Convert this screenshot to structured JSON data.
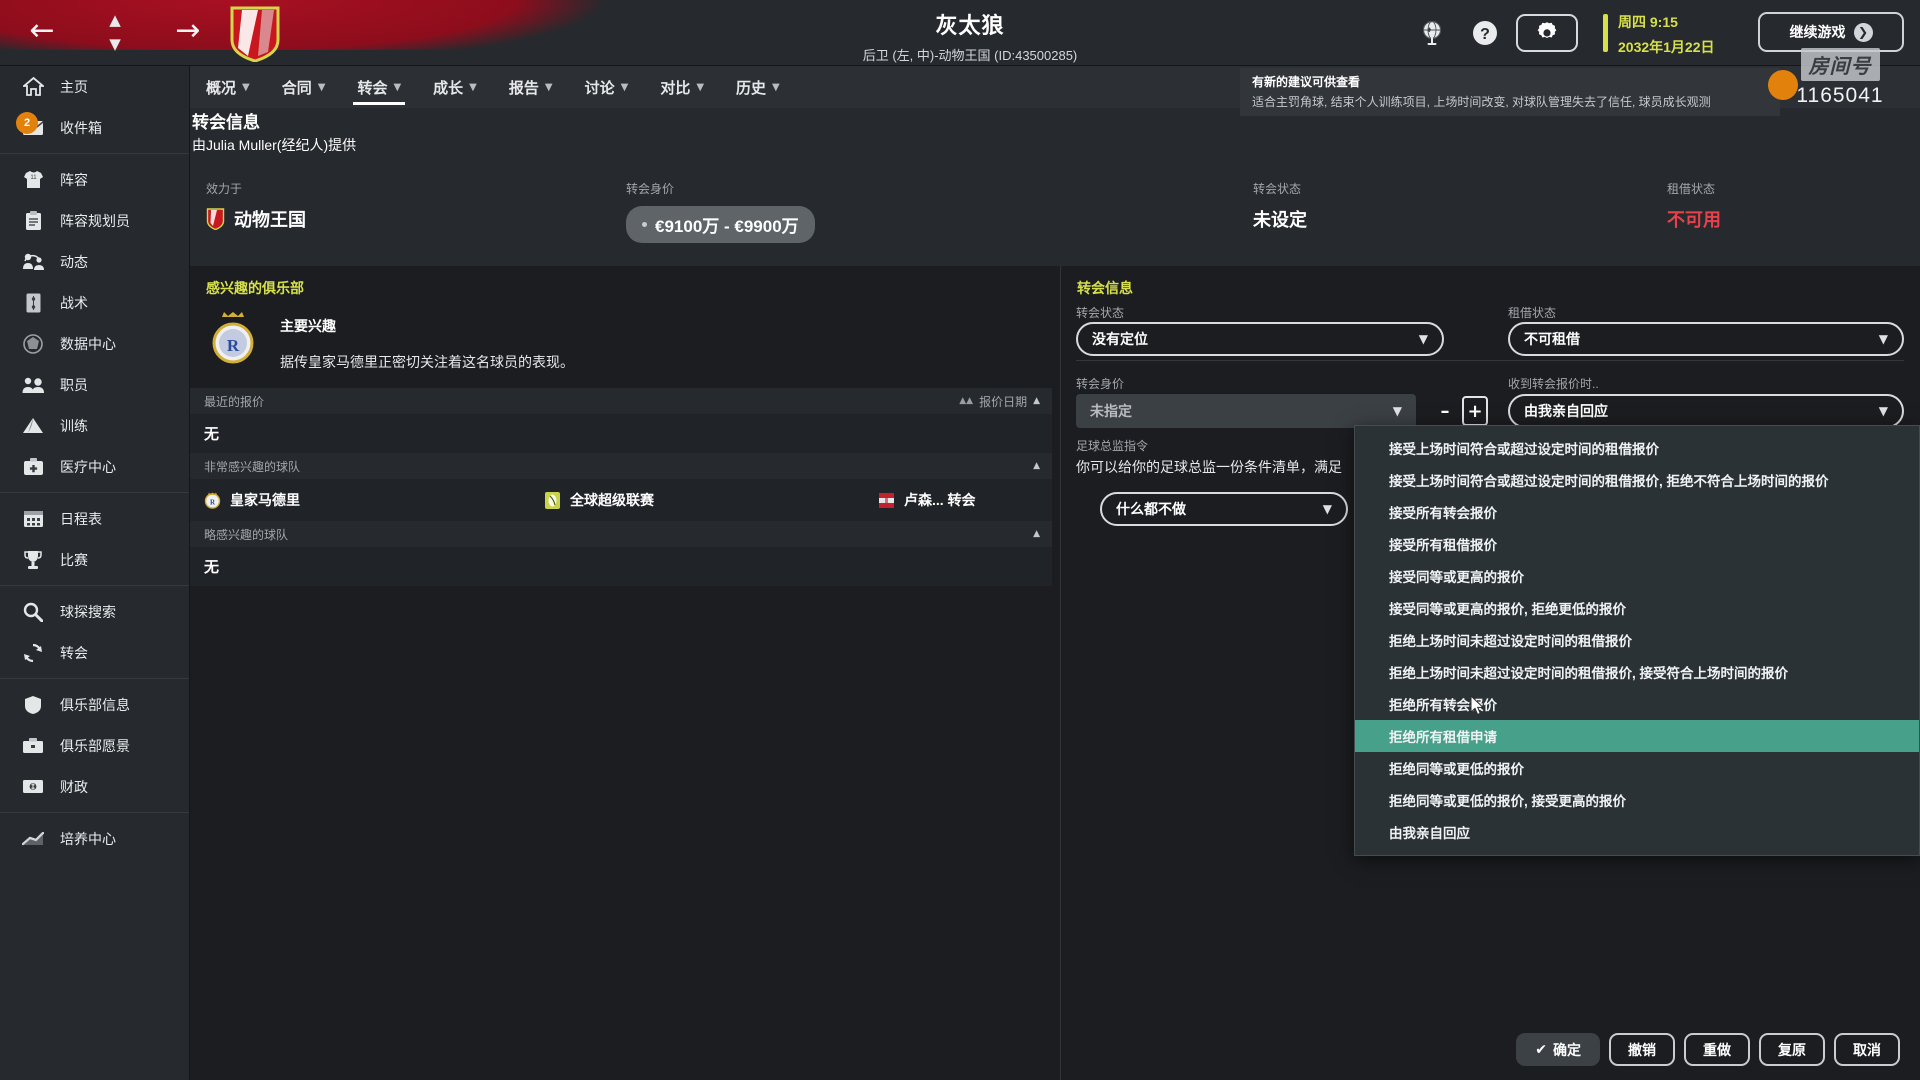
{
  "topbar": {
    "back_icon": "arrow-left-icon",
    "forward_icon": "arrow-right-icon",
    "player_name": "灰太狼",
    "player_subtitle": "后卫 (左, 中)-动物王国 (ID:43500285)",
    "globe_icon": "globe-icon",
    "help_icon": "help-icon",
    "gear_icon": "gear-icon",
    "date_time": "周四 9:15",
    "date_day": "2032年1月22日",
    "continue_label": "继续游戏",
    "date_color": "#d7e04a"
  },
  "sidebar": {
    "items": [
      {
        "label": "主页",
        "icon": "home-icon",
        "badge": ""
      },
      {
        "label": "收件箱",
        "icon": "inbox-icon",
        "badge": "2"
      },
      {
        "label": "阵容",
        "icon": "shirt-icon",
        "badge": ""
      },
      {
        "label": "阵容规划员",
        "icon": "clipboard-icon",
        "badge": ""
      },
      {
        "label": "动态",
        "icon": "activity-icon",
        "badge": ""
      },
      {
        "label": "战术",
        "icon": "tactics-icon",
        "badge": ""
      },
      {
        "label": "数据中心",
        "icon": "data-hub-icon",
        "badge": ""
      },
      {
        "label": "职员",
        "icon": "staff-icon",
        "badge": ""
      },
      {
        "label": "训练",
        "icon": "training-icon",
        "badge": ""
      },
      {
        "label": "医疗中心",
        "icon": "medical-icon",
        "badge": ""
      },
      {
        "label": "日程表",
        "icon": "calendar-icon",
        "badge": ""
      },
      {
        "label": "比赛",
        "icon": "trophy-icon",
        "badge": ""
      },
      {
        "label": "球探搜索",
        "icon": "search-icon",
        "badge": ""
      },
      {
        "label": "转会",
        "icon": "transfer-icon",
        "badge": ""
      },
      {
        "label": "俱乐部信息",
        "icon": "shield-icon",
        "badge": ""
      },
      {
        "label": "俱乐部愿景",
        "icon": "briefcase-icon",
        "badge": ""
      },
      {
        "label": "财政",
        "icon": "money-icon",
        "badge": ""
      },
      {
        "label": "培养中心",
        "icon": "growth-icon",
        "badge": ""
      }
    ]
  },
  "tabs": [
    {
      "label": "概况",
      "active": false
    },
    {
      "label": "合同",
      "active": false
    },
    {
      "label": "转会",
      "active": true
    },
    {
      "label": "成长",
      "active": false
    },
    {
      "label": "报告",
      "active": false
    },
    {
      "label": "讨论",
      "active": false
    },
    {
      "label": "对比",
      "active": false
    },
    {
      "label": "历史",
      "active": false
    }
  ],
  "page": {
    "title": "转会信息",
    "subtitle": "由Julia Muller(经纪人)提供"
  },
  "notification": {
    "title": "有新的建议可供查看",
    "text": "适合主罚角球, 结束个人训练项目, 上场时间改变, 对球队管理失去了信任, 球员成长观测"
  },
  "watermark": {
    "label": "房间号",
    "number": "1165041"
  },
  "info_strip": [
    {
      "label": "效力于",
      "value": "动物王国",
      "style": "crest"
    },
    {
      "label": "转会身价",
      "value": "€9100万 - €9900万",
      "style": "pill"
    },
    {
      "label": "转会状态",
      "value": "未设定",
      "style": "plain"
    },
    {
      "label": "租借状态",
      "value": "不可用",
      "style": "red"
    }
  ],
  "left_panel": {
    "heading": "感兴趣的俱乐部",
    "interest_title": "主要兴趣",
    "interest_desc": "据传皇家马德里正密切关注着这名球员的表现。",
    "sections": [
      {
        "label": "最近的报价",
        "right_label": "报价日期",
        "body": "无"
      },
      {
        "label": "非常感兴趣的球队",
        "right_label": "",
        "body": ""
      },
      {
        "label": "略感兴趣的球队",
        "right_label": "",
        "body": "无"
      }
    ],
    "teams": [
      {
        "label": "皇家马德里",
        "icon": "real-madrid-crest"
      },
      {
        "label": "全球超级联赛",
        "icon": "global-league-crest"
      },
      {
        "label": "卢森... 转会",
        "icon": "luxembourg-crest"
      }
    ]
  },
  "right_panel": {
    "heading": "转会信息",
    "fields": [
      {
        "label": "转会状态",
        "value": "没有定位",
        "type": "select"
      },
      {
        "label": "租借状态",
        "value": "不可租借",
        "type": "select"
      },
      {
        "label": "转会身价",
        "value": "未指定",
        "type": "stepper"
      },
      {
        "label": "收到转会报价时..",
        "value": "由我亲自回应",
        "type": "select"
      }
    ],
    "stepper_minus": "–",
    "stepper_plus": "+",
    "director_label": "足球总监指令",
    "director_desc": "你可以给你的足球总监一份条件清单，满足",
    "director_value": "什么都不做"
  },
  "dropdown": {
    "selected_index": 9,
    "checked_index": 13,
    "highlight_color": "#47a08a",
    "items": [
      "接受上场时间符合或超过设定时间的租借报价",
      "接受上场时间符合或超过设定时间的租借报价, 拒绝不符合上场时间的报价",
      "接受所有转会报价",
      "接受所有租借报价",
      "接受同等或更高的报价",
      "接受同等或更高的报价, 拒绝更低的报价",
      "拒绝上场时间未超过设定时间的租借报价",
      "拒绝上场时间未超过设定时间的租借报价, 接受符合上场时间的报价",
      "拒绝所有转会报价",
      "拒绝所有租借申请",
      "拒绝同等或更低的报价",
      "拒绝同等或更低的报价, 接受更高的报价",
      "由我亲自回应"
    ]
  },
  "bottom_buttons": [
    {
      "label": "确定",
      "filled": true,
      "tick": "✔"
    },
    {
      "label": "撤销",
      "filled": false,
      "tick": ""
    },
    {
      "label": "重做",
      "filled": false,
      "tick": ""
    },
    {
      "label": "复原",
      "filled": false,
      "tick": ""
    },
    {
      "label": "取消",
      "filled": false,
      "tick": ""
    }
  ]
}
